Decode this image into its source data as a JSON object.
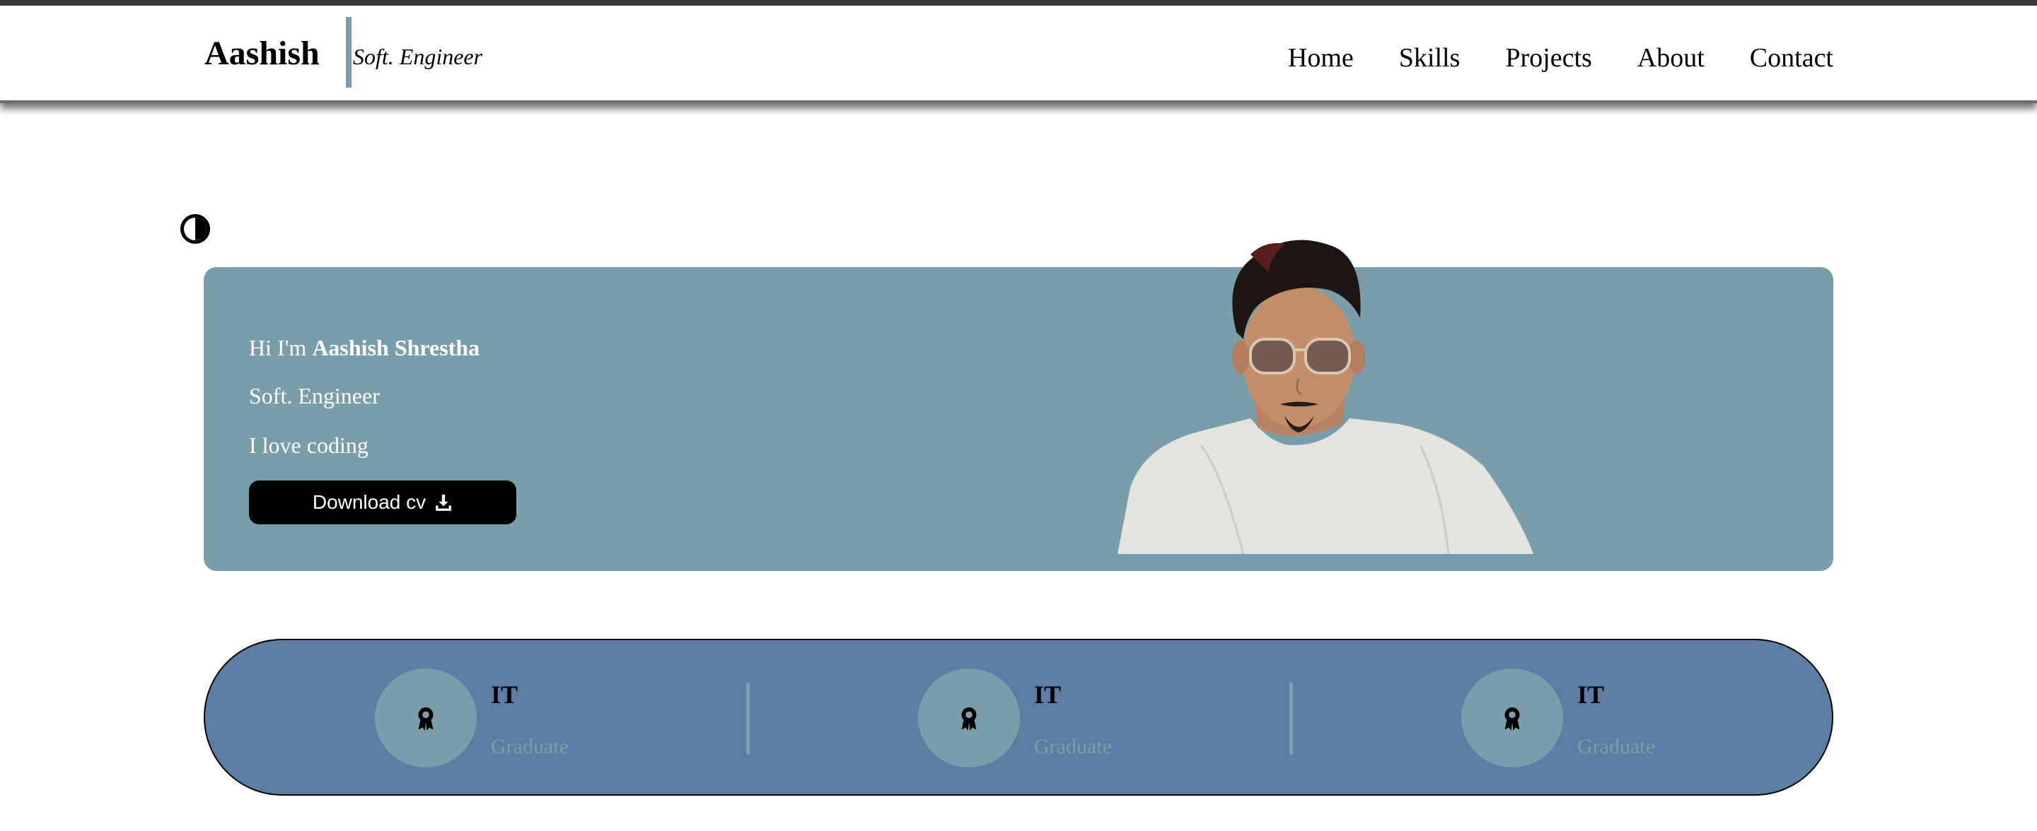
{
  "header": {
    "brand": "Aashish",
    "tagline": "Soft. Engineer",
    "nav": [
      "Home",
      "Skills",
      "Projects",
      "About",
      "Contact"
    ]
  },
  "theme_toggle": {
    "icon": "contrast-half-circle-icon"
  },
  "hero": {
    "greeting_prefix": "Hi I'm ",
    "name": "Aashish Shrestha",
    "role": "Soft. Engineer",
    "tagline": "I love coding",
    "download_label": "Download cv",
    "download_icon": "download-icon"
  },
  "stats": [
    {
      "title": "IT",
      "subtitle": "Graduate",
      "icon": "award-icon"
    },
    {
      "title": "IT",
      "subtitle": "Graduate",
      "icon": "award-icon"
    },
    {
      "title": "IT",
      "subtitle": "Graduate",
      "icon": "award-icon"
    }
  ],
  "colors": {
    "accent": "#7a9ea9",
    "stats_background": "#5c7ea4",
    "button_background": "#000000",
    "text_on_accent": "#ffffff"
  }
}
